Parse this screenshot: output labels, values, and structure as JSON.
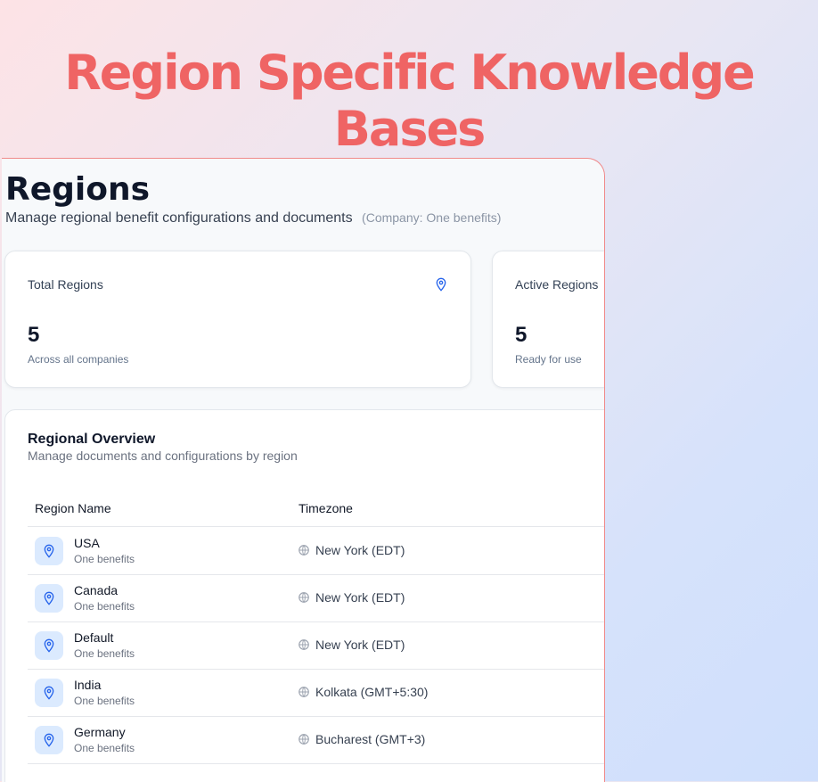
{
  "hero": {
    "title": "Region Specific Knowledge Bases"
  },
  "page": {
    "title": "Regions",
    "subtitle": "Manage regional benefit configurations and documents",
    "company_note": "(Company: One benefits)"
  },
  "stats": [
    {
      "label": "Total Regions",
      "value": "5",
      "note": "Across all companies",
      "icon": "map-pin-icon"
    },
    {
      "label": "Active Regions",
      "value": "5",
      "note": "Ready for use"
    }
  ],
  "overview": {
    "title": "Regional Overview",
    "subtitle": "Manage documents and configurations by region",
    "columns": [
      "Region Name",
      "Timezone"
    ],
    "rows": [
      {
        "name": "USA",
        "company": "One benefits",
        "timezone": "New York (EDT)"
      },
      {
        "name": "Canada",
        "company": "One benefits",
        "timezone": "New York (EDT)"
      },
      {
        "name": "Default",
        "company": "One benefits",
        "timezone": "New York (EDT)"
      },
      {
        "name": "India",
        "company": "One benefits",
        "timezone": "Kolkata (GMT+5:30)"
      },
      {
        "name": "Germany",
        "company": "One benefits",
        "timezone": "Bucharest (GMT+3)"
      }
    ]
  },
  "colors": {
    "hero": "#ef6464",
    "accent": "#2563eb",
    "pin_bg": "#dbeafe"
  }
}
